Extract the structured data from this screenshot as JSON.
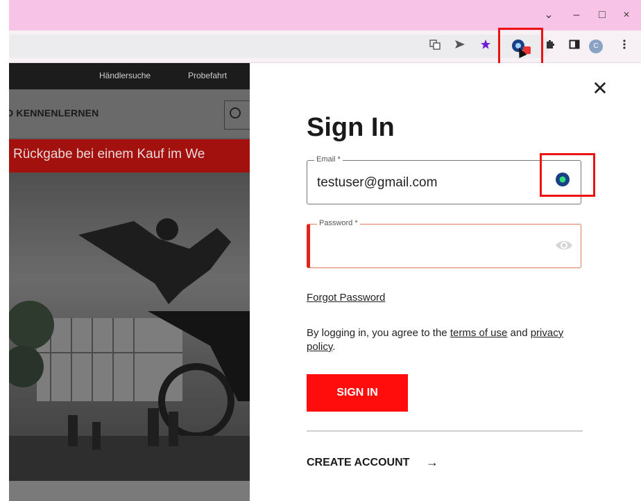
{
  "browser": {
    "window_buttons": {
      "chevron": "⌄",
      "minimize": "–",
      "maximize": "□",
      "close": "×"
    },
    "toolbar_icons": [
      "translate-icon",
      "send-icon",
      "star-icon",
      "extension-icon",
      "puzzle-icon",
      "sidebar-icon",
      "profile-avatar",
      "menu-icon"
    ],
    "avatar_letter": "C",
    "extension_badge": "1"
  },
  "background_page": {
    "nav": {
      "dealer_search": "Händlersuche",
      "test_ride": "Probefahrt"
    },
    "brand_text": "D KENNENLERNEN",
    "promo_text": "Rückgabe bei einem Kauf im We"
  },
  "signin_panel": {
    "title": "Sign In",
    "email_label": "Email *",
    "email_value": "testuser@gmail.com",
    "password_label": "Password *",
    "password_value": "",
    "forgot_password": "Forgot Password",
    "terms_prefix": "By logging in, you agree to the ",
    "terms_link": "terms of use",
    "terms_middle": " and ",
    "privacy_link": "privacy policy",
    "terms_suffix": ".",
    "signin_button": "SIGN IN",
    "create_account": "CREATE ACCOUNT",
    "create_arrow": "→",
    "close_glyph": "✕"
  },
  "colors": {
    "accent_red": "#ff0d0d",
    "titlebar_pink": "#f7c3e6",
    "highlight": "#ee1111"
  }
}
